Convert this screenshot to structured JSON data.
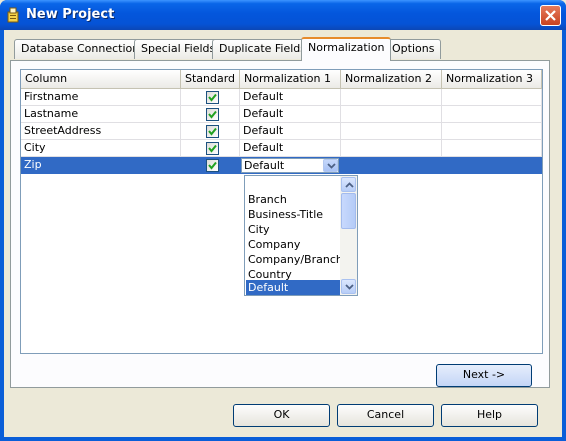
{
  "window": {
    "title": "New Project",
    "colors": {
      "titlebar": "#0a5ed8",
      "face": "#ece9d8",
      "selection": "#316ac5",
      "active_tab_accent": "#e68b2c"
    }
  },
  "tabs": [
    {
      "label": "Database Connection",
      "active": false
    },
    {
      "label": "Special Fields",
      "active": false
    },
    {
      "label": "Duplicate Fields",
      "active": false
    },
    {
      "label": "Normalization",
      "active": true
    },
    {
      "label": "Options",
      "active": false
    }
  ],
  "grid": {
    "columns": [
      "Column",
      "Standard",
      "Normalization 1",
      "Normalization 2",
      "Normalization 3"
    ],
    "rows": [
      {
        "column": "Firstname",
        "standard": true,
        "norm1": "Default",
        "norm2": "",
        "norm3": ""
      },
      {
        "column": "Lastname",
        "standard": true,
        "norm1": "Default",
        "norm2": "",
        "norm3": ""
      },
      {
        "column": "StreetAddress",
        "standard": true,
        "norm1": "Default",
        "norm2": "",
        "norm3": ""
      },
      {
        "column": "City",
        "standard": true,
        "norm1": "Default",
        "norm2": "",
        "norm3": ""
      },
      {
        "column": "Zip",
        "standard": true,
        "norm1": "Default",
        "norm2": "",
        "norm3": "",
        "selected": true
      }
    ]
  },
  "dropdown": {
    "options": [
      "",
      "Branch",
      "Business-Title",
      "City",
      "Company",
      "Company/Branch",
      "Country",
      "Default"
    ],
    "selected": "Default"
  },
  "buttons": {
    "next": "Next ->",
    "ok": "OK",
    "cancel": "Cancel",
    "help": "Help"
  }
}
